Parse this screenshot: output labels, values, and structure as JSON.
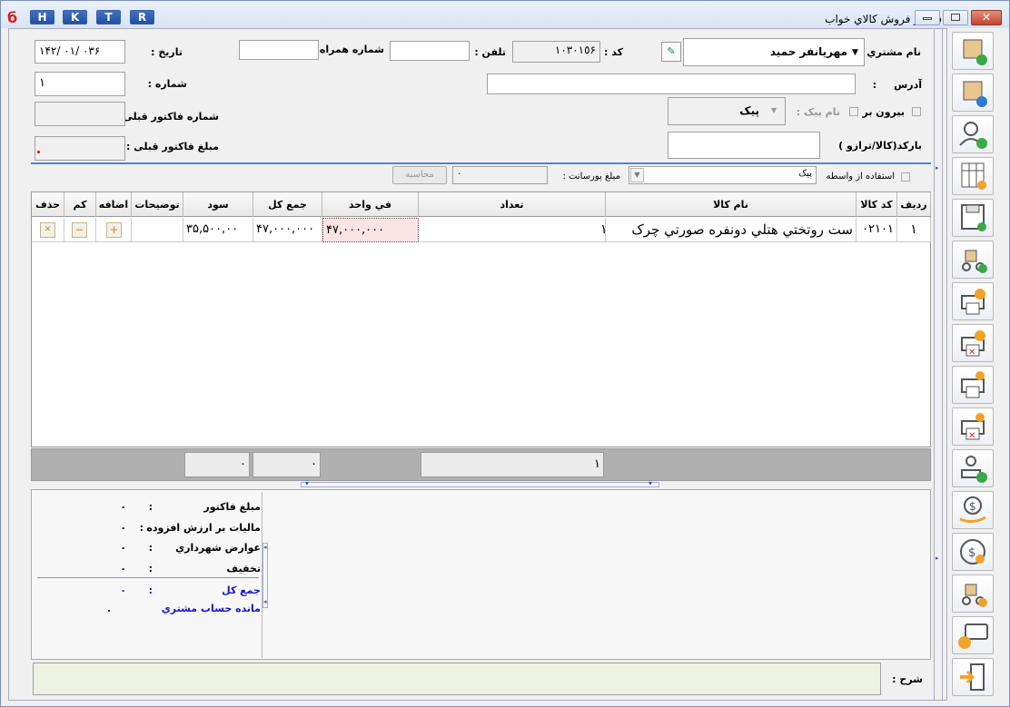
{
  "window": {
    "title": "فاكتور فروش كالاي خواب",
    "top_buttons": [
      "H",
      "K",
      "T",
      "R"
    ]
  },
  "header": {
    "customer_label": "نام مشتري :",
    "customer_value": "مهريانفر حميد",
    "code_label": "كد :",
    "code_value": "١٠٣٠١٥۶",
    "phone_label": "تلفن   :",
    "mobile_label": "شماره همراه :",
    "date_label": "تاريخ :",
    "date_value": "١۴٠٣  /٠١  /٢۶",
    "address_label": "آدرس",
    "address_sep": ":",
    "number_label": "شماره :",
    "number_value": "١",
    "outside_label": "بيرون بر",
    "courier_name_label": "نام پيک :",
    "courier_value": "پيک",
    "prev_invoice_no_label": "شماره فاكتور قبلی :",
    "barcode_label": "بارکد(کالا/ترازو )",
    "prev_invoice_amount_label": "مبلغ فاكتور قبلی :",
    "use_agent_label": "استفاده از واسطه",
    "agent_value": "پيک",
    "commission_label": "مبلغ پورسانت :",
    "commission_value": "٠",
    "calc_button": "محاسبه"
  },
  "grid": {
    "columns": [
      "رديف",
      "كد كالا",
      "نام كالا",
      "تعداد",
      "في واحد",
      "جمع كل",
      "سود",
      "توضيحات",
      "اضافه",
      "كم",
      "حذف"
    ],
    "rows": [
      {
        "row": "١",
        "code": "٠٢١٠١",
        "name": "ست روتختي هتلي دونفره صورتي چرک",
        "qty": "١",
        "unit": "۴٧,٠٠٠,٠٠٠",
        "total": "۴٧,٠٠٠,٠٠٠",
        "profit": "٣۵,۵٠٠,٠٠",
        "desc": ""
      }
    ]
  },
  "summary": {
    "qty_total": "١",
    "total": "٠",
    "profit": "٠"
  },
  "totals": {
    "invoice_amount_label": "مبلغ فاكتور",
    "vat_label": "ماليات بر ارزش افزوده",
    "municipal_label": "عوارض شهرداري",
    "discount_label": "تخفيف",
    "grand_total_label": "جمع كل",
    "customer_balance_label": "مانده حساب مشتري",
    "colon": ":",
    "zero": "٠",
    "dot": "."
  },
  "notes": {
    "label": "شرح :",
    "value": ""
  },
  "sidebar": [
    "box-add-icon",
    "box-edit-icon",
    "user-add-icon",
    "calendar-icon",
    "save-view-icon",
    "delivery-view-icon",
    "printer-money-icon",
    "printer-cancel-icon",
    "printer-money2-icon",
    "printer-cancel2-icon",
    "stamp-check-icon",
    "money-hand-icon",
    "money-cancel-icon",
    "delivery-icon",
    "chat-upload-icon",
    "exit-icon"
  ]
}
